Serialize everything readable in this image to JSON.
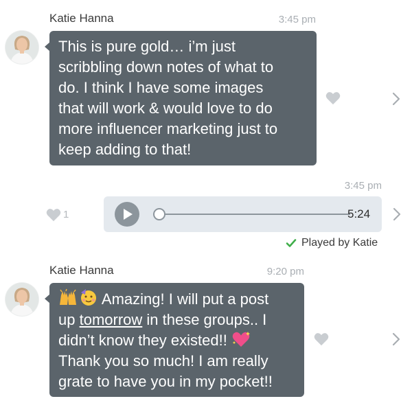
{
  "messages": [
    {
      "sender": "Katie Hanna",
      "time": "3:45 pm",
      "lines": [
        "This is pure gold… i’m just",
        "scribbling down notes of what to",
        "do. I think I have some images",
        "that will work & would love to do",
        "more influencer marketing just to",
        "keep adding to that!"
      ],
      "avatar_icon": "woman-portrait-icon",
      "reaction_icon": "heart-icon"
    },
    {
      "time": "3:45 pm",
      "type": "voice-note",
      "duration": "5:24",
      "progress": 0,
      "like_count": "1",
      "status": "Played by Katie",
      "status_icon": "checkmark-icon"
    },
    {
      "sender": "Katie Hanna",
      "time": "9:20 pm",
      "line1_emoji": [
        "raised-hands-emoji",
        "partying-face-emoji"
      ],
      "line1_text": "Amazing! I will put a post",
      "line2_pre": "up ",
      "line2_link": "tomorrow",
      "line2_post": " in these groups.. I",
      "line3_text": "didn’t know they existed!!",
      "line3_emoji": "sparkling-heart-emoji",
      "line4": "Thank you so much! I am really",
      "line5": "grate to have you in my pocket!!",
      "avatar_icon": "woman-portrait-icon",
      "reaction_icon": "heart-icon"
    }
  ],
  "colors": {
    "incoming_bubble": "#5b646b",
    "audio_bubble": "#e4e9ee",
    "heart": "#c9cdd1",
    "check": "#3fae49"
  }
}
